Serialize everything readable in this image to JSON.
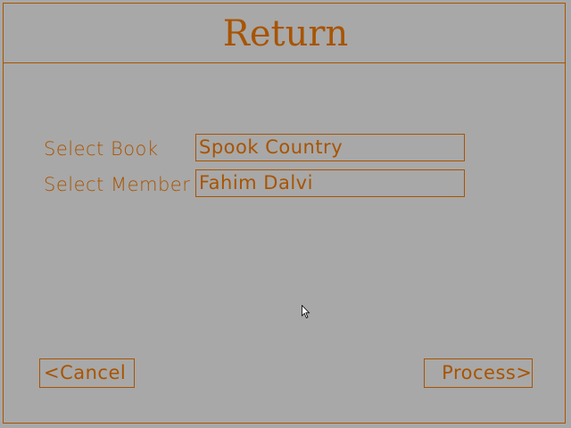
{
  "window": {
    "title": "Return"
  },
  "form": {
    "book_label": "Select Book",
    "book_value": "Spook Country",
    "member_label": "Select Member",
    "member_value": "Fahim Dalvi"
  },
  "buttons": {
    "cancel_label": "<Cancel",
    "process_label": " Process>"
  },
  "colors": {
    "background": "#a8a8a8",
    "accent": "#a85400"
  },
  "icons": {
    "pointer": "mouse-pointer-icon"
  }
}
